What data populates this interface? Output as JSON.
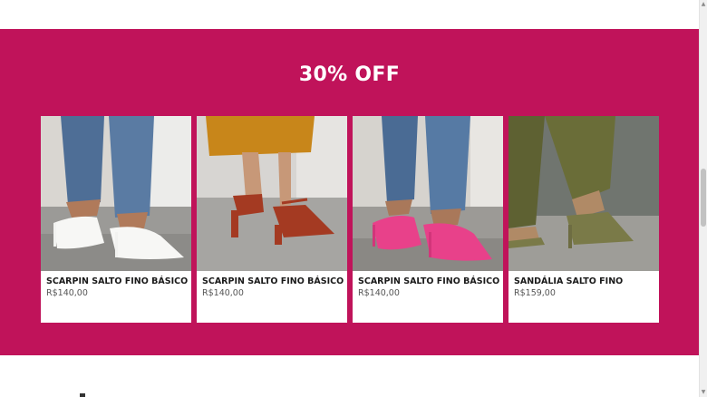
{
  "promo": {
    "title": "30% OFF"
  },
  "products": [
    {
      "name": "SCARPIN SALTO FINO BÁSICO",
      "price": "R$140,00",
      "photo": "white-stiletto-pumps"
    },
    {
      "name": "SCARPIN SALTO FINO BÁSICO",
      "price": "R$140,00",
      "photo": "red-strappy-block-heel-sandals"
    },
    {
      "name": "SCARPIN SALTO FINO BÁSICO",
      "price": "R$140,00",
      "photo": "pink-stiletto-pumps"
    },
    {
      "name": "SANDÁLIA SALTO FINO",
      "price": "R$159,00",
      "photo": "olive-strappy-sandals"
    }
  ],
  "colors": {
    "promo_background": "#c0135a",
    "card_background": "#ffffff",
    "text_dark": "#1a1a1a",
    "text_price": "#555555"
  }
}
